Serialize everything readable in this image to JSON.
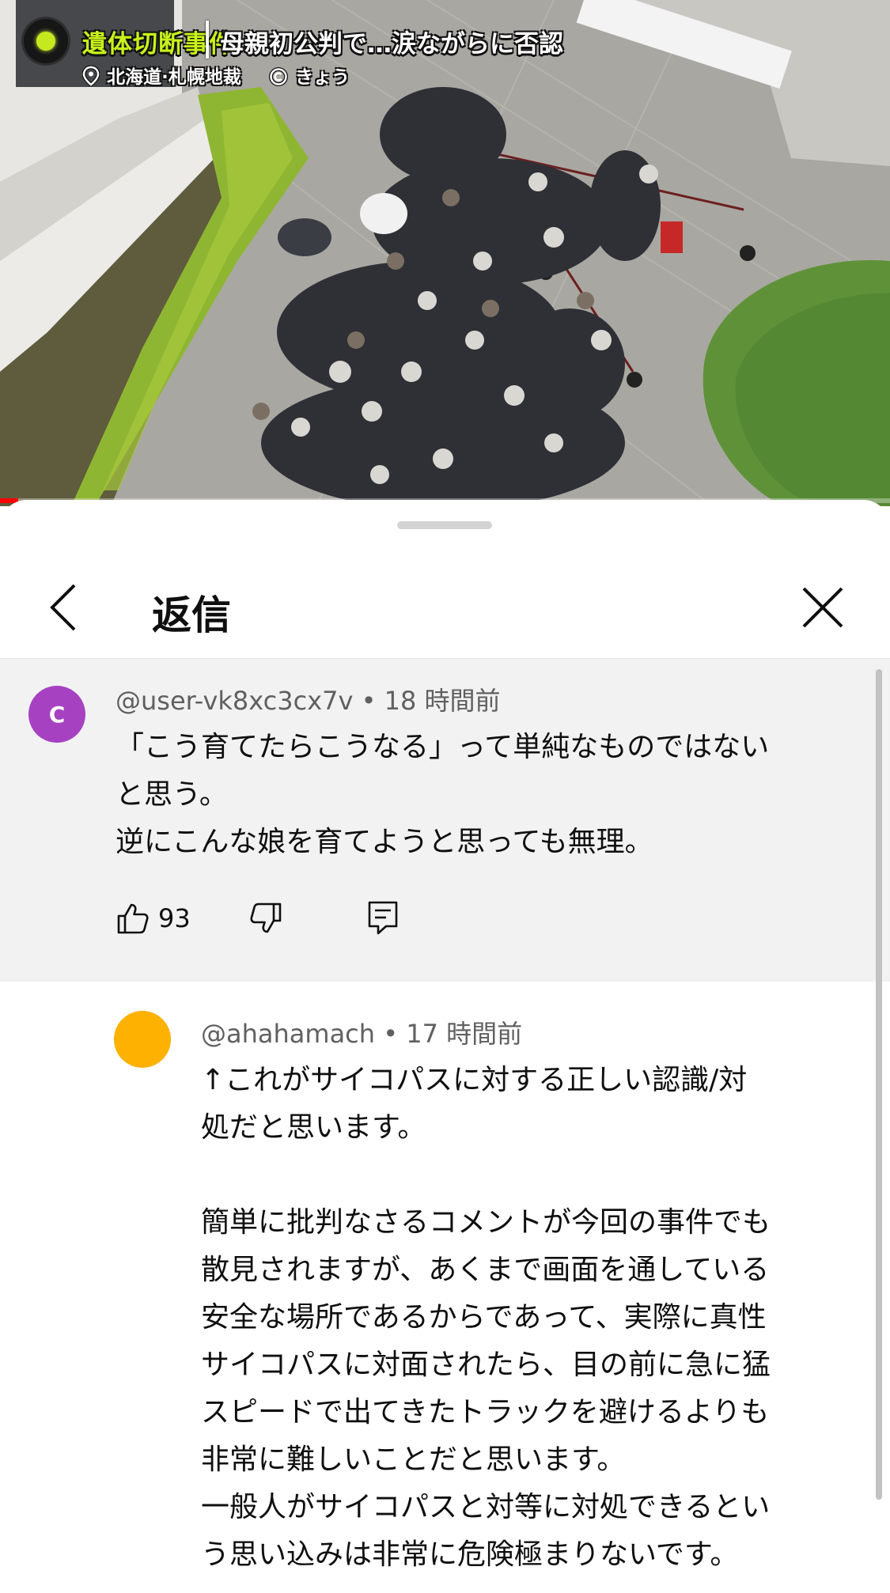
{
  "video": {
    "tag": "遺体切断事件",
    "headline": "母親初公判で…涙ながらに否認",
    "location": "北海道·札幌地裁",
    "credit": "きょう",
    "progress_fraction": 0.02
  },
  "sheet": {
    "title": "返信",
    "icons": {
      "back": "chevron-left-icon",
      "close": "close-icon"
    }
  },
  "parent_comment": {
    "avatar_letter": "C",
    "avatar_color": "#a642c2",
    "meta": "@user-vk8xc3cx7v • 18 時間前",
    "text": "「こう育てたらこうなる」って単純なものではない\nと思う。\n逆にこんな娘を育てようと思っても無理。",
    "like_count": "93",
    "icons": {
      "like": "thumb-up-icon",
      "dislike": "thumb-down-icon",
      "reply": "reply-icon"
    }
  },
  "reply": {
    "avatar_color": "#ffb100",
    "meta": "@ahahamach • 17 時間前",
    "text": "↑これがサイコパスに対する正しい認識/対\n処だと思います。\n\n簡単に批判なさるコメントが今回の事件でも\n散見されますが、あくまで画面を通している\n安全な場所であるからであって、実際に真性\nサイコパスに対面されたら、目の前に急に猛\nスピードで出てきたトラックを避けるよりも\n非常に難しいことだと思います。\n一般人がサイコパスと対等に対処できるとい\nう思い込みは非常に危険極まりないです。"
  }
}
